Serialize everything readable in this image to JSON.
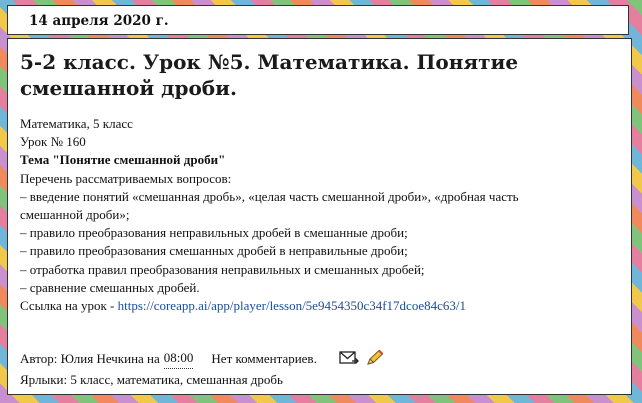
{
  "date_header": "14 апреля 2020 г.",
  "post": {
    "title": "5-2 класс. Урок №5. Математика. Понятие смешанной дроби.",
    "lines": [
      "Математика, 5 класс",
      "Урок № 160",
      "Тема \"Понятие смешанной дроби\"",
      "Перечень рассматриваемых вопросов:",
      "– введение понятий «смешанная дробь», «целая часть смешанной дроби», «дробная часть",
      "смешанной дроби»;",
      "– правило преобразования неправильных дробей в смешанные дроби;",
      "– правило преобразования смешанных дробей в неправильные дроби;",
      "– отработка правил преобразования неправильных и смешанных дробей;",
      "– сравнение смешанных дробей."
    ],
    "link_prefix": "Ссылка на урок - ",
    "link_text": "https://coreapp.ai/app/player/lesson/5e9454350c34f17dcoe84c63/1"
  },
  "footer": {
    "author_prefix": "Автор: Юлия Нечкина на",
    "time": "08:00",
    "comments": "Нет комментариев.",
    "labels": "Ярлыки: 5 класс, математика, смешанная дробь",
    "email_icon": "email-post-icon",
    "edit_icon": "edit-pencil-icon"
  },
  "colors": {
    "link": "#1a4e9c",
    "text": "#111111",
    "panel": "#ffffff"
  }
}
